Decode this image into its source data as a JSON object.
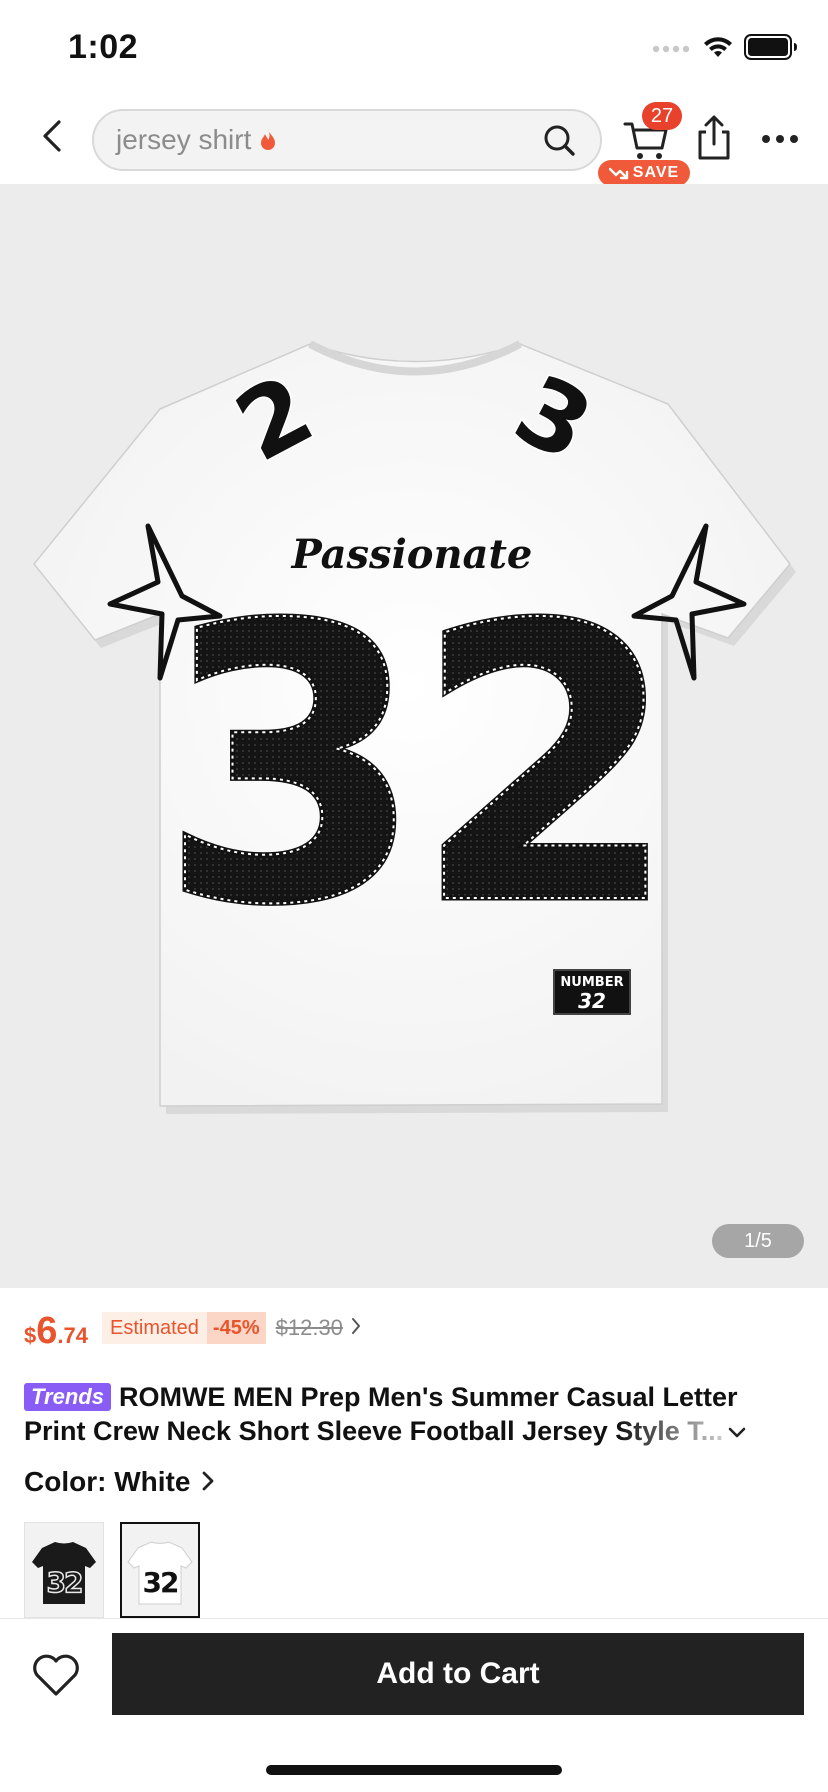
{
  "status_bar": {
    "time": "1:02"
  },
  "header": {
    "search_query": "jersey shirt",
    "cart_count": "27",
    "save_label": "SAVE"
  },
  "product_image": {
    "counter": "1/5",
    "jersey_script": "Passionate",
    "jersey_number": "32",
    "tag_label": "NUMBER",
    "tag_number": "32",
    "left_shoulder_number": "2",
    "right_shoulder_number": "3"
  },
  "price": {
    "currency": "$",
    "integer": "6",
    "decimal": ".74",
    "estimated_label": "Estimated",
    "discount": "-45%",
    "original": "$12.30"
  },
  "title": {
    "badge": "Trends",
    "line1": "ROMWE MEN Prep Men's Summer Casual Letter",
    "line2": "Print Crew Neck Short Sleeve Football Jersey Style T..."
  },
  "color": {
    "label": "Color: White",
    "options": [
      {
        "name": "Black",
        "number": "32",
        "selected": false
      },
      {
        "name": "White",
        "number": "32",
        "selected": true
      }
    ]
  },
  "bottom_bar": {
    "add_to_cart": "Add to Cart"
  },
  "colors": {
    "accent": "#e8542c",
    "badge_red": "#e8412c",
    "trends_purple": "#8a5cf6",
    "cta_bg": "#222222"
  }
}
